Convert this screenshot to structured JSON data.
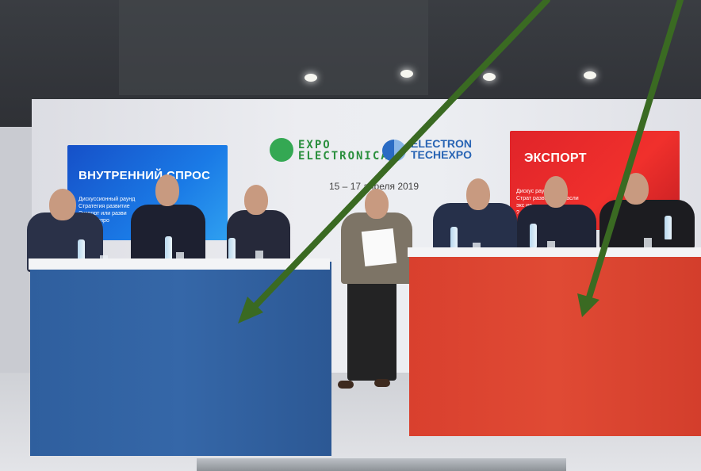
{
  "photo": {
    "screen_left": {
      "title": "ВНУТРЕННИЙ СПРОС",
      "line1": "Дискуссионный раунд",
      "line2": "Стратегия развитие",
      "line3": "Экспорт или разви",
      "line4": "енного спро"
    },
    "screen_right": {
      "title": "ЭКСПОРТ",
      "line1": "Дискус        раунд",
      "line2": "Страт     развития отрасли",
      "line3": "экс              ие",
      "line4": "?"
    },
    "logo_expo": "EXPO ELECTRONICA",
    "logo_electron": "ELECTRON TECHEXPO",
    "date_text": "15 – 17 апреля 2019",
    "arrow_color": "#3a6a22",
    "desk_left_color": "#3567a8",
    "desk_right_color": "#e04a34",
    "icons": [
      "arrow-icon",
      "arrow-icon"
    ]
  }
}
